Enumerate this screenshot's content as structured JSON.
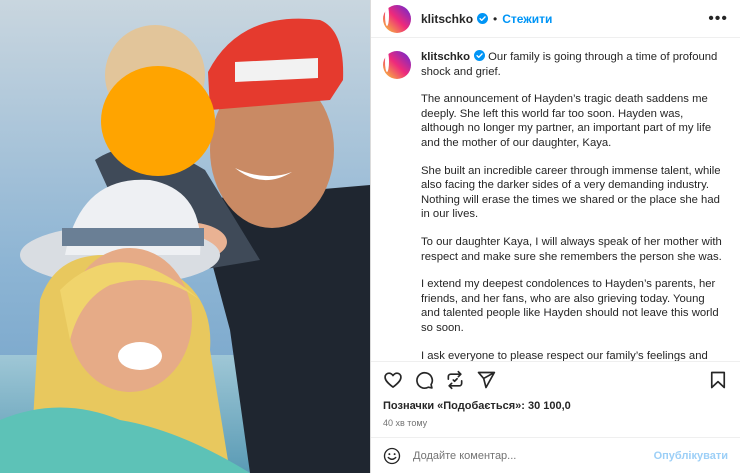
{
  "post": {
    "username": "klitschko",
    "follow_label": "Стежити",
    "separator": "•",
    "more_label": "•••",
    "caption_opening": "Our family is going through a time of profound shock and grief.",
    "paragraphs": [
      "The announcement of Hayden’s tragic death saddens me deeply. She left this world far too soon. Hayden was, although no longer my partner, an important part of my life and the mother of our daughter, Kaya.",
      "She built an incredible career through immense talent, while also facing the darker sides of a very demanding industry. Nothing will erase the times we shared or the place she had in our lives.",
      "To our daughter Kaya, I will always speak of her mother with respect and make sure she remembers the person she was.",
      "I extend my deepest condolences to Hayden’s parents, her friends, and her fans, who are also grieving today. Young and talented people like Hayden should not leave this world so soon.",
      "I ask everyone to please respect our family’s feelings and privacy during this incredibly difficult time. For now, this is all I wish to say."
    ],
    "likes_text": "Позначки «Подобається»: 30 100,0",
    "time_ago": "40 хв тому"
  },
  "comment": {
    "placeholder": "Додайте коментар...",
    "post_label": "Опублікувати"
  },
  "colors": {
    "accent": "#0095f6",
    "post_disabled": "#9ccff7",
    "blur_face": "#ffa400"
  },
  "icons": [
    "heart-icon",
    "comment-icon",
    "repost-icon",
    "share-icon",
    "bookmark-icon",
    "emoji-icon",
    "verified-badge-icon",
    "more-options-icon"
  ]
}
